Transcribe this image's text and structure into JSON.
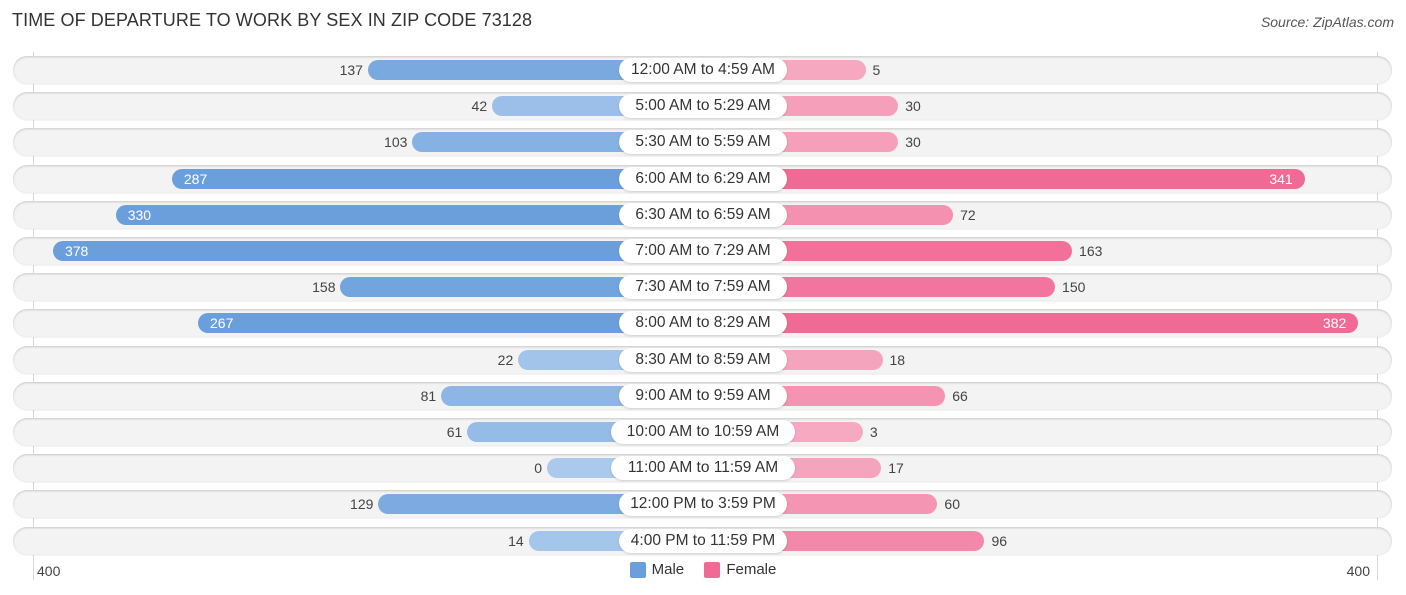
{
  "chart_data": {
    "type": "bar",
    "orientation": "horizontal-diverging",
    "title": "TIME OF DEPARTURE TO WORK BY SEX IN ZIP CODE 73128",
    "source": "Source: ZipAtlas.com",
    "categories": [
      "12:00 AM to 4:59 AM",
      "5:00 AM to 5:29 AM",
      "5:30 AM to 5:59 AM",
      "6:00 AM to 6:29 AM",
      "6:30 AM to 6:59 AM",
      "7:00 AM to 7:29 AM",
      "7:30 AM to 7:59 AM",
      "8:00 AM to 8:29 AM",
      "8:30 AM to 8:59 AM",
      "9:00 AM to 9:59 AM",
      "10:00 AM to 10:59 AM",
      "11:00 AM to 11:59 AM",
      "12:00 PM to 3:59 PM",
      "4:00 PM to 11:59 PM"
    ],
    "series": [
      {
        "name": "Male",
        "color": "#6a9fdc",
        "values": [
          137,
          42,
          103,
          287,
          330,
          378,
          158,
          267,
          22,
          81,
          61,
          0,
          129,
          14
        ]
      },
      {
        "name": "Female",
        "color": "#f06a96",
        "values": [
          5,
          30,
          30,
          341,
          72,
          163,
          150,
          382,
          18,
          66,
          3,
          17,
          60,
          96
        ]
      }
    ],
    "axis": {
      "left_label": "400",
      "right_label": "400",
      "max": 400
    },
    "legend": {
      "position": "bottom-center",
      "items": [
        "Male",
        "Female"
      ]
    },
    "xlabel": "",
    "ylabel": ""
  },
  "colors": {
    "male_dark": "#6a9fdc",
    "male_light": "#aac9ec",
    "female_dark": "#f06a96",
    "female_light": "#f6aac2"
  }
}
